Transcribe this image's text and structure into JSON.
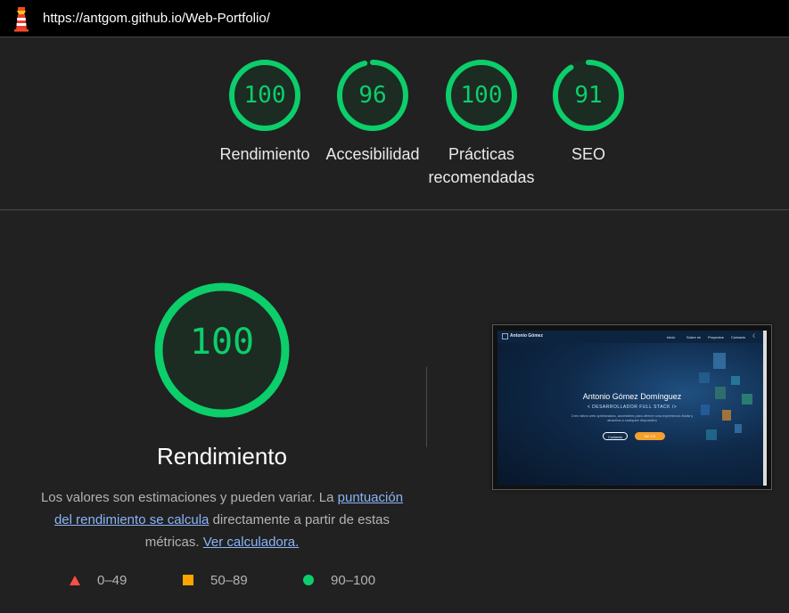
{
  "header": {
    "url": "https://antgom.github.io/Web-Portfolio/"
  },
  "colors": {
    "pass": "#0cce6b",
    "average": "#ffa400",
    "fail": "#ff4e42",
    "link": "#8ab4f8"
  },
  "scores": [
    {
      "value": "100",
      "score": 1.0,
      "label": "Rendimiento"
    },
    {
      "value": "96",
      "score": 0.96,
      "label": "Accesibilidad"
    },
    {
      "value": "100",
      "score": 1.0,
      "label": "Prácticas recomendadas"
    },
    {
      "value": "91",
      "score": 0.91,
      "label": "SEO"
    }
  ],
  "performance": {
    "value": "100",
    "score": 1.0,
    "title": "Rendimiento",
    "desc_prefix": "Los valores son estimaciones y pueden variar. La ",
    "desc_link": "puntuación del rendimiento se calcula",
    "desc_middle": " directamente a partir de estas métricas. ",
    "calc_link": "Ver calculadora."
  },
  "legend": [
    {
      "shape": "triangle",
      "range": "0–49"
    },
    {
      "shape": "square",
      "range": "50–89"
    },
    {
      "shape": "circle",
      "range": "90–100"
    }
  ],
  "thumbnail": {
    "brand": "Antonio Gómez",
    "nav": [
      "Inicio",
      "Sobre mí",
      "Proyectos",
      "Contacto"
    ],
    "hero_title": "Antonio Gómez Domínguez",
    "hero_sub": "< DESARROLLADOR FULL STACK /> ",
    "hero_text": "Creo sitios web optimizados, accesibles para ofrecer una experiencia fluida y atractiva a cualquier dispositivo",
    "button_contact": "Contacto",
    "button_cv": "Ver CV"
  }
}
